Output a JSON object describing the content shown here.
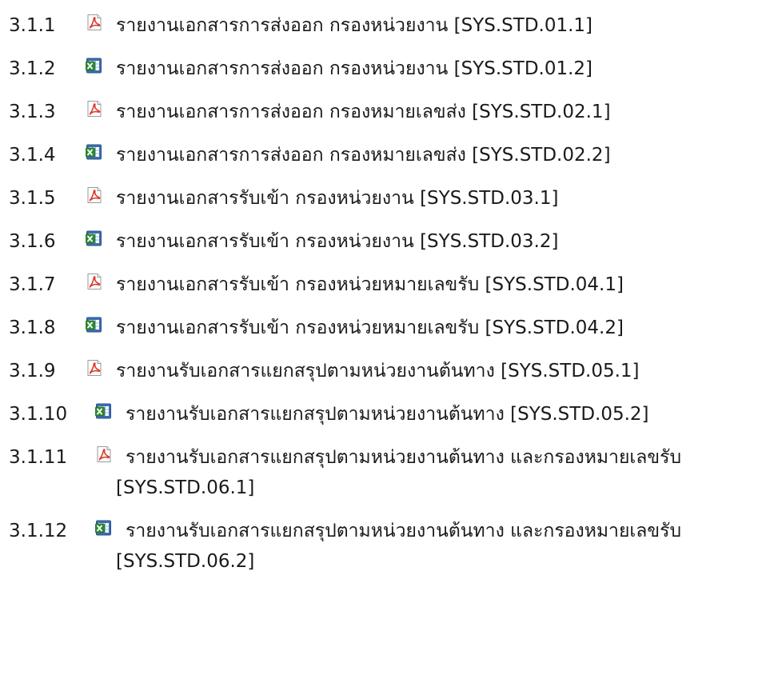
{
  "reports": [
    {
      "number": "3.1.1",
      "icon": "pdf-icon",
      "title": "รายงานเอกสารการส่งออก กรองหน่วยงาน",
      "code": "[SYS.STD.01.1]"
    },
    {
      "number": "3.1.2",
      "icon": "excel-icon",
      "title": "รายงานเอกสารการส่งออก กรองหน่วยงาน",
      "code": "[SYS.STD.01.2]"
    },
    {
      "number": "3.1.3",
      "icon": "pdf-icon",
      "title": "รายงานเอกสารการส่งออก กรองหมายเลขส่ง",
      "code": "[SYS.STD.02.1]"
    },
    {
      "number": "3.1.4",
      "icon": "excel-icon",
      "title": "รายงานเอกสารการส่งออก กรองหมายเลขส่ง",
      "code": "[SYS.STD.02.2]"
    },
    {
      "number": "3.1.5",
      "icon": "pdf-icon",
      "title": "รายงานเอกสารรับเข้า กรองหน่วยงาน",
      "code": "[SYS.STD.03.1]"
    },
    {
      "number": "3.1.6",
      "icon": "excel-icon",
      "title": "รายงานเอกสารรับเข้า กรองหน่วยงาน",
      "code": "[SYS.STD.03.2]"
    },
    {
      "number": "3.1.7",
      "icon": "pdf-icon",
      "title": "รายงานเอกสารรับเข้า กรองหน่วยหมายเลขรับ",
      "code": "[SYS.STD.04.1]"
    },
    {
      "number": "3.1.8",
      "icon": "excel-icon",
      "title": "รายงานเอกสารรับเข้า กรองหน่วยหมายเลขรับ",
      "code": "[SYS.STD.04.2]"
    },
    {
      "number": "3.1.9",
      "icon": "pdf-icon",
      "title": "รายงานรับเอกสารแยกสรุปตามหน่วยงานต้นทาง",
      "code": "[SYS.STD.05.1]"
    },
    {
      "number": "3.1.10",
      "icon": "excel-icon",
      "title": "รายงานรับเอกสารแยกสรุปตามหน่วยงานต้นทาง",
      "code": "[SYS.STD.05.2]"
    },
    {
      "number": "3.1.11",
      "icon": "pdf-icon",
      "title": "รายงานรับเอกสารแยกสรุปตามหน่วยงานต้นทาง และกรองหมายเลขรับ",
      "code": "[SYS.STD.06.1]"
    },
    {
      "number": "3.1.12",
      "icon": "excel-icon",
      "title": "รายงานรับเอกสารแยกสรุปตามหน่วยงานต้นทาง และกรองหมายเลขรับ",
      "code": "[SYS.STD.06.2]"
    }
  ],
  "colors": {
    "pdf_red": "#d93a2b",
    "excel_green": "#2e8b2e",
    "excel_blue": "#3b6fb6"
  }
}
